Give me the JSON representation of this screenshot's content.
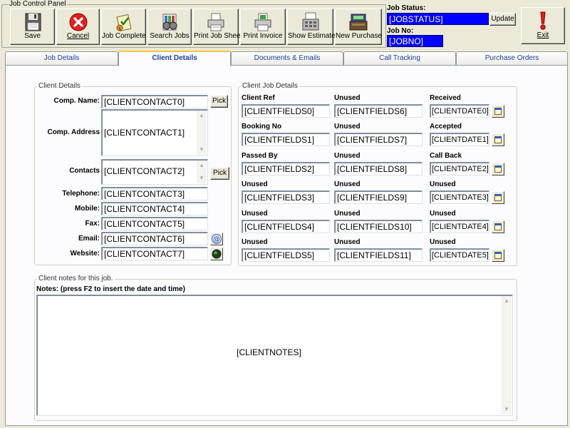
{
  "panel": {
    "caption": "Job Control Panel"
  },
  "toolbar": {
    "buttons": [
      {
        "label": "Save"
      },
      {
        "label": "Cancel"
      },
      {
        "label": "Job Complete"
      },
      {
        "label": "Search Jobs"
      },
      {
        "label": "Print Job Sheet"
      },
      {
        "label": "Print Invoice"
      },
      {
        "label": "Show Estimate"
      },
      {
        "label": "New Purchase"
      }
    ],
    "exit_label": "Exit"
  },
  "job": {
    "status_label": "Job Status:",
    "status_value": "[JOBSTATUS]",
    "update_label": "Update",
    "no_label": "Job No:",
    "no_value": "[JOBNO]"
  },
  "tabs": [
    {
      "label": "Job Details"
    },
    {
      "label": "Client Details"
    },
    {
      "label": "Documents & Emails"
    },
    {
      "label": "Call Tracking"
    },
    {
      "label": "Purchase Orders"
    }
  ],
  "client_details": {
    "caption": "Client Details",
    "pick_label": "Pick",
    "fields": [
      {
        "label": "Comp. Name:",
        "value": "[CLIENTCONTACT0]"
      },
      {
        "label": "Comp. Address",
        "value": "[CLIENTCONTACT1]"
      },
      {
        "label": "Contacts",
        "value": "[CLIENTCONTACT2]"
      },
      {
        "label": "Telephone:",
        "value": "[CLIENTCONTACT3]"
      },
      {
        "label": "Mobile:",
        "value": "[CLIENTCONTACT4]"
      },
      {
        "label": "Fax:",
        "value": "[CLIENTCONTACT5]"
      },
      {
        "label": "Email:",
        "value": "[CLIENTCONTACT6]"
      },
      {
        "label": "Website:",
        "value": "[CLIENTCONTACT7]"
      }
    ]
  },
  "client_job": {
    "caption": "Client Job Details",
    "col1": [
      {
        "label": "Client Ref",
        "value": "[CLIENTFIELDS0]"
      },
      {
        "label": "Booking No",
        "value": "[CLIENTFIELDS1]"
      },
      {
        "label": "Passed By",
        "value": "[CLIENTFIELDS2]"
      },
      {
        "label": "Unused",
        "value": "[CLIENTFIELDS3]"
      },
      {
        "label": "Unused",
        "value": "[CLIENTFIELDS4]"
      },
      {
        "label": "Unused",
        "value": "[CLIENTFIELDS5]"
      }
    ],
    "col2": [
      {
        "label": "Unused",
        "value": "[CLIENTFIELDS6]"
      },
      {
        "label": "Unused",
        "value": "[CLIENTFIELDS7]"
      },
      {
        "label": "Unused",
        "value": "[CLIENTFIELDS8]"
      },
      {
        "label": "Unused",
        "value": "[CLIENTFIELDS9]"
      },
      {
        "label": "Unused",
        "value": "[CLIENTFIELDS10]"
      },
      {
        "label": "Unused",
        "value": "[CLIENTFIELDS11]"
      }
    ],
    "col3": [
      {
        "label": "Received",
        "value": "[CLIENTDATE0]"
      },
      {
        "label": "Accepted",
        "value": "[CLIENTDATE1]"
      },
      {
        "label": "Call Back",
        "value": "[CLIENTDATE2]"
      },
      {
        "label": "Unused",
        "value": "[CLIENTDATE3]"
      },
      {
        "label": "Unused",
        "value": "[CLIENTDATE4]"
      },
      {
        "label": "Unused",
        "value": "[CLIENTDATE5]"
      }
    ]
  },
  "notes": {
    "caption": "Client notes for this job.",
    "label": "Notes: (press F2 to insert the date and time)",
    "value": "[CLIENTNOTES]"
  },
  "colors": {
    "window_bg": "#ECE9D8",
    "status_field_bg": "#0000FF",
    "active_tab_accent": "#FFC83C",
    "tab_text": "#1A3FA8"
  }
}
